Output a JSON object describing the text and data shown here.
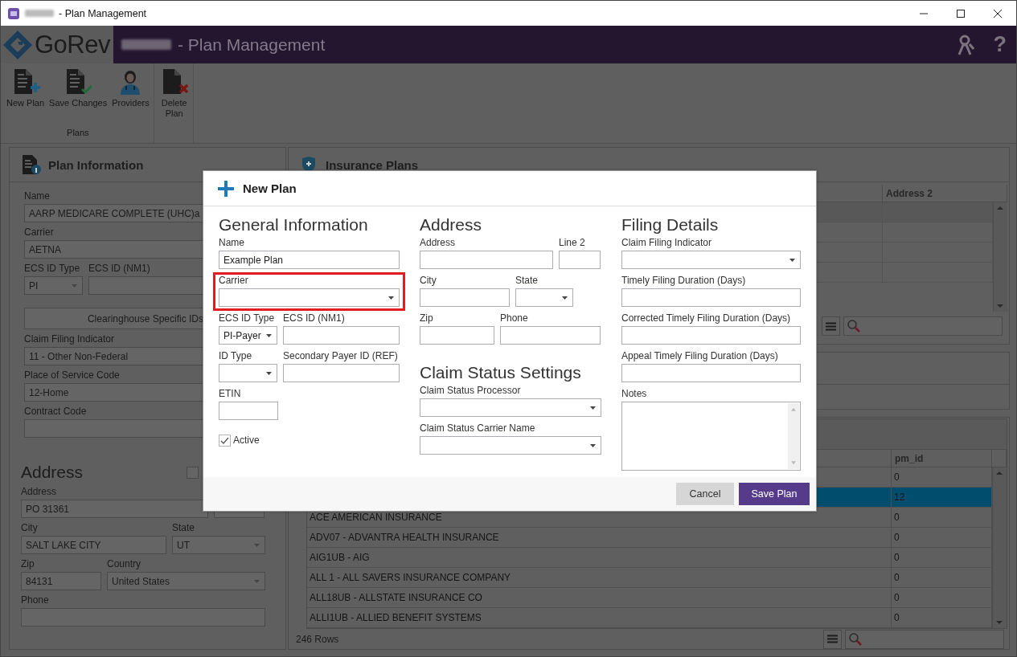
{
  "window": {
    "title": "- Plan Management"
  },
  "header": {
    "logo": "GoRev",
    "title": "- Plan Management",
    "help": "?"
  },
  "toolbar": {
    "group": "Plans",
    "buttons": [
      {
        "label": "New Plan",
        "kind": "new"
      },
      {
        "label": "Save Changes",
        "kind": "save"
      },
      {
        "label": "Providers",
        "kind": "providers"
      },
      {
        "label": "Delete\nPlan",
        "kind": "delete"
      }
    ]
  },
  "plan_information": {
    "title": "Plan Information",
    "blocks": [
      {
        "kind": "row",
        "fields": [
          {
            "kind": "text",
            "label": "Name",
            "value": "AARP MEDICARE COMPLETE (UHC)a"
          }
        ]
      },
      {
        "kind": "row",
        "fields": [
          {
            "kind": "select",
            "label": "Carrier",
            "value": "AETNA"
          }
        ]
      },
      {
        "kind": "row",
        "fields": [
          {
            "kind": "select",
            "label": "ECS ID Type",
            "value": "PI"
          },
          {
            "kind": "text",
            "label": "ECS ID (NM1)"
          }
        ]
      },
      {
        "kind": "row",
        "fields": [
          {
            "kind": "button",
            "value": "Clearinghouse Specific IDs"
          }
        ]
      },
      {
        "kind": "row",
        "fields": [
          {
            "kind": "select",
            "label": "Claim Filing Indicator",
            "value": "11 - Other Non-Federal"
          }
        ]
      },
      {
        "kind": "row",
        "fields": [
          {
            "kind": "select",
            "label": "Place of Service Code",
            "value": "12-Home"
          }
        ]
      },
      {
        "kind": "row",
        "fields": [
          {
            "kind": "text",
            "label": "Contract Code"
          }
        ]
      },
      {
        "kind": "heading",
        "text": "Address",
        "checked": false
      },
      {
        "kind": "row",
        "fields": [
          {
            "kind": "text",
            "label": "Address",
            "value": "PO 31361"
          },
          {
            "kind": "text"
          }
        ]
      },
      {
        "kind": "row",
        "fields": [
          {
            "kind": "text",
            "label": "City",
            "value": "SALT LAKE CITY"
          },
          {
            "kind": "select",
            "label": "State",
            "value": "UT"
          }
        ]
      },
      {
        "kind": "row",
        "fields": [
          {
            "kind": "text",
            "label": "Zip",
            "value": "84131"
          },
          {
            "kind": "select",
            "label": "Country",
            "value": "United States"
          }
        ]
      },
      {
        "kind": "row",
        "fields": [
          {
            "kind": "text",
            "label": "Phone"
          }
        ]
      }
    ]
  },
  "insurance_plans": {
    "title": "Insurance Plans",
    "columns": [
      "Address 2"
    ]
  },
  "payers_table": {
    "columns": [
      "pm_id"
    ],
    "footer": "246 Rows",
    "rows": [
      {
        "pm_id": "0",
        "selected": false
      },
      {
        "pm_id": "12",
        "selected": true
      },
      {
        "name": "ACE AMERICAN INSURANCE",
        "pm_id": "0",
        "selected": false
      },
      {
        "name": "ADV07 - ADVANTRA HEALTH INSURANCE",
        "pm_id": "0",
        "selected": false
      },
      {
        "name": "AIG1UB - AIG",
        "pm_id": "0",
        "selected": false
      },
      {
        "name": "ALL 1 - ALL SAVERS INSURANCE COMPANY",
        "pm_id": "0",
        "selected": false
      },
      {
        "name": "ALL18UB - ALLSTATE INSURANCE CO",
        "pm_id": "0",
        "selected": false
      },
      {
        "name": "ALLI1UB - ALLIED BENEFIT SYSTEMS",
        "pm_id": "0",
        "selected": false
      }
    ]
  },
  "modal": {
    "title": "New Plan",
    "cancel": "Cancel",
    "save": "Save Plan",
    "columns": [
      {
        "blocks": [
          {
            "kind": "heading",
            "text": "General Information"
          },
          {
            "kind": "row",
            "fields": [
              {
                "kind": "text",
                "label": "Name",
                "value": "Example Plan"
              }
            ]
          },
          {
            "kind": "row",
            "fields": [
              {
                "kind": "select",
                "label": "Carrier",
                "highlighted": true
              }
            ]
          },
          {
            "kind": "row",
            "fields": [
              {
                "kind": "select",
                "label": "ECS ID Type",
                "value": "PI-Payer"
              },
              {
                "kind": "text",
                "label": "ECS ID (NM1)"
              }
            ]
          },
          {
            "kind": "row",
            "fields": [
              {
                "kind": "select",
                "label": "ID Type"
              },
              {
                "kind": "text",
                "label": "Secondary Payer ID (REF)"
              }
            ]
          },
          {
            "kind": "row",
            "fields": [
              {
                "kind": "text",
                "label": "ETIN"
              }
            ]
          },
          {
            "kind": "row",
            "fields": [
              {
                "kind": "checkbox",
                "label": "Active",
                "checked": true
              }
            ]
          }
        ]
      },
      {
        "blocks": [
          {
            "kind": "heading",
            "text": "Address"
          },
          {
            "kind": "row",
            "fields": [
              {
                "kind": "text",
                "label": "Address"
              },
              {
                "kind": "text",
                "label": "Line 2"
              }
            ]
          },
          {
            "kind": "row",
            "fields": [
              {
                "kind": "text",
                "label": "City"
              },
              {
                "kind": "select",
                "label": "State"
              }
            ]
          },
          {
            "kind": "row",
            "fields": [
              {
                "kind": "text",
                "label": "Zip"
              },
              {
                "kind": "text",
                "label": "Phone"
              }
            ]
          },
          {
            "kind": "heading",
            "text": "Claim Status Settings"
          },
          {
            "kind": "row",
            "fields": [
              {
                "kind": "select",
                "label": "Claim Status Processor"
              }
            ]
          },
          {
            "kind": "row",
            "fields": [
              {
                "kind": "select",
                "label": "Claim Status Carrier Name"
              }
            ]
          }
        ]
      },
      {
        "blocks": [
          {
            "kind": "heading",
            "text": "Filing Details"
          },
          {
            "kind": "row",
            "fields": [
              {
                "kind": "select",
                "label": "Claim Filing Indicator"
              }
            ]
          },
          {
            "kind": "row",
            "fields": [
              {
                "kind": "text",
                "label": "Timely Filing Duration (Days)"
              }
            ]
          },
          {
            "kind": "row",
            "fields": [
              {
                "kind": "text",
                "label": "Corrected Timely Filing Duration (Days)"
              }
            ]
          },
          {
            "kind": "row",
            "fields": [
              {
                "kind": "text",
                "label": "Appeal Timely Filing Duration (Days)"
              }
            ]
          },
          {
            "kind": "row",
            "fields": [
              {
                "kind": "textarea",
                "label": "Notes"
              }
            ]
          }
        ]
      }
    ]
  }
}
